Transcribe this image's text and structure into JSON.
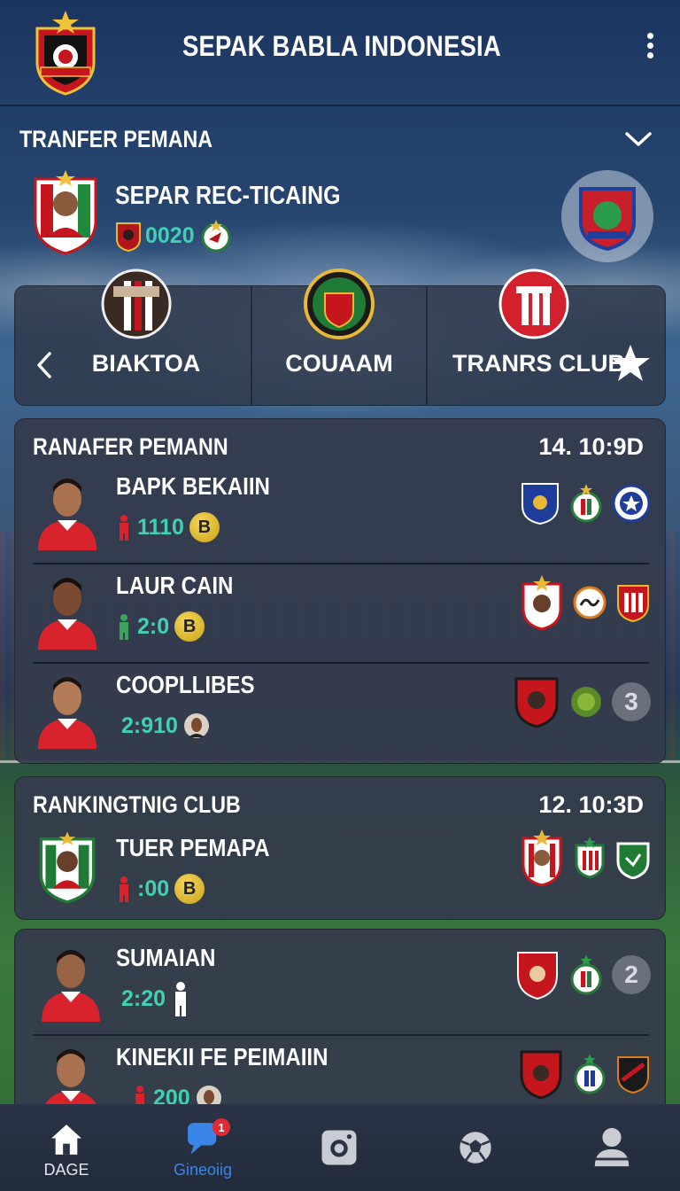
{
  "header": {
    "title": "SEPAK BABLA INDONESIA"
  },
  "transfer": {
    "title": "TRANFER PEMANA",
    "featured": {
      "name": "SEPAR REC-TICAING",
      "value": "0020"
    }
  },
  "clubs": [
    {
      "label": "BIAKTOA"
    },
    {
      "label": "COUAAM"
    },
    {
      "label": "TRANRS CLUB"
    }
  ],
  "card1": {
    "title": "RANAFER PEMANN",
    "time": "14. 10:9D",
    "players": [
      {
        "name": "BAPK BEKAIIN",
        "stat": "1110",
        "coin": "B"
      },
      {
        "name": "LAUR CAIN",
        "stat": "2:0",
        "coin": "B"
      },
      {
        "name": "COOPLLIBES",
        "stat": "2:910",
        "badge": "3"
      }
    ]
  },
  "card2": {
    "title": "RANKINGTNIG CLUB",
    "time": "12. 10:3D",
    "players": [
      {
        "name": "TUER PEMAPA",
        "stat": ":00",
        "coin": "B"
      }
    ]
  },
  "card3": {
    "players": [
      {
        "name": "SUMAIAN",
        "stat": "2:20",
        "badge": "2"
      },
      {
        "name": "KINEKII FE PEIMAIIN",
        "stat": "200"
      }
    ]
  },
  "nav": [
    {
      "label": "DAGE",
      "icon": "home-icon"
    },
    {
      "label": "Gineoiig",
      "icon": "chat-icon",
      "badge": "1",
      "active": true
    },
    {
      "label": "",
      "icon": "camera-icon"
    },
    {
      "label": "",
      "icon": "football-icon"
    },
    {
      "label": "",
      "icon": "profile-icon"
    }
  ],
  "colors": {
    "accent": "#3fd1b2",
    "navActive": "#3a86e8",
    "badge": "#e02b35"
  }
}
